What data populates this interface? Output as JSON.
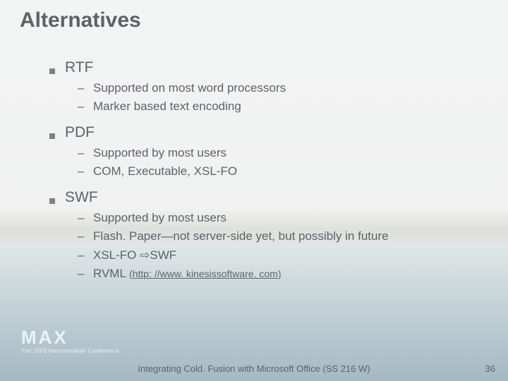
{
  "title": "Alternatives",
  "items": [
    {
      "label": "RTF",
      "subs": [
        {
          "text": "Supported on most word processors"
        },
        {
          "text": "Marker based text encoding"
        }
      ]
    },
    {
      "label": "PDF",
      "subs": [
        {
          "text": "Supported by most users"
        },
        {
          "text": "COM, Executable, XSL-FO"
        }
      ]
    },
    {
      "label": "SWF",
      "subs": [
        {
          "text": "Supported by most users"
        },
        {
          "text": "Flash. Paper—not server-side yet, but possibly in future"
        },
        {
          "pre": "XSL-FO ",
          "arrow": "⇨",
          "post": "SWF"
        },
        {
          "pre": "RVML ",
          "link": "(http: //www. kinesissoftware. com)"
        }
      ]
    }
  ],
  "brand": {
    "top": "MAX",
    "sub": "The 2003 Macromedia® Conference"
  },
  "footer": "Integrating Cold. Fusion with Microsoft Office (SS 216 W)",
  "page": "36"
}
